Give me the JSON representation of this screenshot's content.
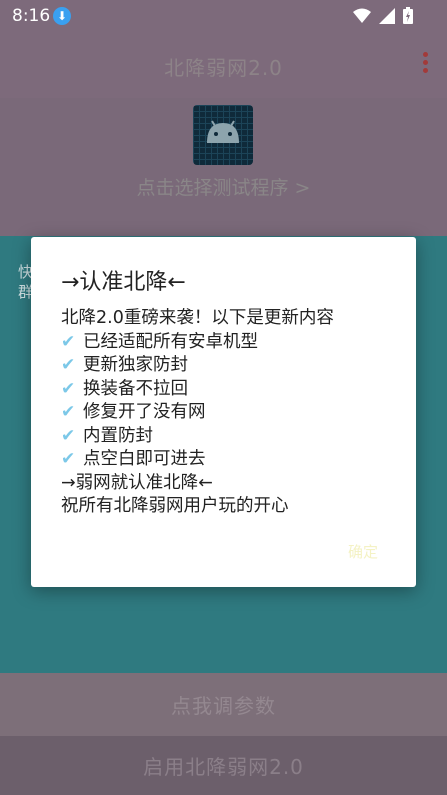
{
  "status_bar": {
    "time": "8:16"
  },
  "toolbar": {
    "title": "北降弱网2.0"
  },
  "header": {
    "select_program": "点击选择测试程序 >"
  },
  "content": {
    "line1": "快",
    "line2": "群"
  },
  "buttons": {
    "params": "点我调参数",
    "enable": "启用北降弱网2.0"
  },
  "dialog": {
    "title": "→认准北降←",
    "intro": "北降2.0重磅来袭！以下是更新内容",
    "check_items": [
      "已经适配所有安卓机型",
      "更新独家防封",
      "换装备不拉回",
      "修复开了没有网",
      "内置防封",
      "点空白即可进去"
    ],
    "slogan": "→弱网就认准北降←",
    "wish": "祝所有北降弱网用户玩的开心",
    "ok_label": "确定"
  },
  "colors": {
    "accent": "#2f7a80",
    "toolbar": "#7d6a7b",
    "check": "#7cc8e8"
  }
}
